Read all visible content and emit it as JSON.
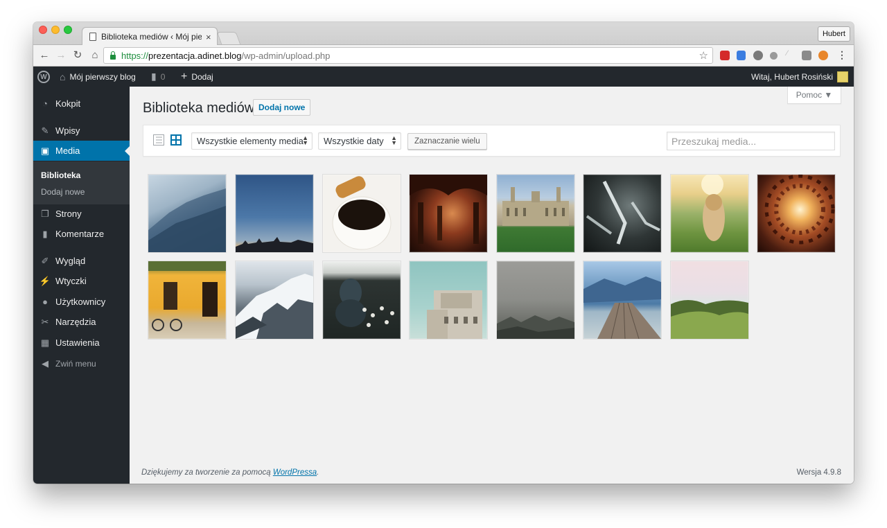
{
  "browser": {
    "tab_title": "Biblioteka mediów ‹ Mój pierwszy blog",
    "tab_close": "×",
    "profile_name": "Hubert",
    "url_scheme": "https://",
    "url_host": "prezentacja.adinet.blog",
    "url_path": "/wp-admin/upload.php"
  },
  "adminbar": {
    "site_name": "Mój pierwszy blog",
    "comments_count": "0",
    "new_label": "Dodaj",
    "greeting": "Witaj, Hubert Rosiński"
  },
  "sidebar": {
    "items": [
      {
        "label": "Kokpit",
        "icon": "dashboard-icon"
      },
      {
        "label": "Wpisy",
        "icon": "pin-icon"
      },
      {
        "label": "Media",
        "icon": "media-icon"
      },
      {
        "label": "Strony",
        "icon": "pages-icon"
      },
      {
        "label": "Komentarze",
        "icon": "comments-icon"
      },
      {
        "label": "Wygląd",
        "icon": "appearance-icon"
      },
      {
        "label": "Wtyczki",
        "icon": "plugins-icon"
      },
      {
        "label": "Użytkownicy",
        "icon": "users-icon"
      },
      {
        "label": "Narzędzia",
        "icon": "tools-icon"
      },
      {
        "label": "Ustawienia",
        "icon": "settings-icon"
      }
    ],
    "submenu": [
      "Biblioteka",
      "Dodaj nowe"
    ],
    "collapse_label": "Zwiń menu"
  },
  "main": {
    "help_label": "Pomoc ▼",
    "title": "Biblioteka mediów",
    "add_new_label": "Dodaj nowe",
    "filter_type": "Wszystkie elementy media",
    "filter_date": "Wszystkie daty",
    "bulk_select_label": "Zaznaczanie wielu",
    "search_placeholder": "Przeszukaj media...",
    "media_items": [
      "misty-mountains",
      "city-skyline-dusk",
      "coffee-honey",
      "arched-corridor",
      "college-building",
      "forks-closeup",
      "girl-in-field",
      "tower-looking-up",
      "yellow-house-bicycle",
      "snowy-mountains",
      "woman-with-flowers",
      "concrete-building",
      "foggy-valley",
      "wooden-pier-lake",
      "green-hills"
    ]
  },
  "footer": {
    "thanks_prefix": "Dziękujemy za tworzenie za pomocą ",
    "thanks_link": "WordPressa",
    "thanks_suffix": ".",
    "version": "Wersja 4.9.8"
  }
}
